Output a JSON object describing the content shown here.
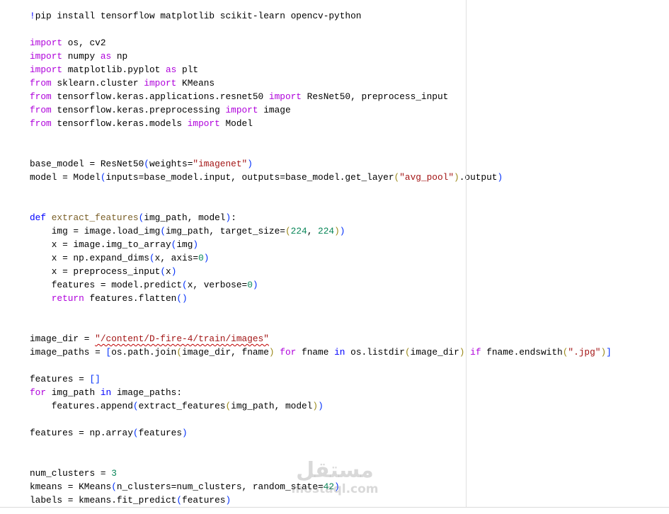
{
  "code_lines": [
    [
      [
        "b",
        "!"
      ],
      [
        "t",
        "pip install tensorflow matplotlib scikit-learn opencv-python"
      ]
    ],
    [],
    [
      [
        "k",
        "import"
      ],
      [
        "t",
        " os, cv2"
      ]
    ],
    [
      [
        "k",
        "import"
      ],
      [
        "t",
        " numpy "
      ],
      [
        "k",
        "as"
      ],
      [
        "t",
        " np"
      ]
    ],
    [
      [
        "k",
        "import"
      ],
      [
        "t",
        " matplotlib.pyplot "
      ],
      [
        "k",
        "as"
      ],
      [
        "t",
        " plt"
      ]
    ],
    [
      [
        "k",
        "from"
      ],
      [
        "t",
        " sklearn.cluster "
      ],
      [
        "k",
        "import"
      ],
      [
        "t",
        " KMeans"
      ]
    ],
    [
      [
        "k",
        "from"
      ],
      [
        "t",
        " tensorflow.keras.applications.resnet50 "
      ],
      [
        "k",
        "import"
      ],
      [
        "t",
        " ResNet50, preprocess_input"
      ]
    ],
    [
      [
        "k",
        "from"
      ],
      [
        "t",
        " tensorflow.keras.preprocessing "
      ],
      [
        "k",
        "import"
      ],
      [
        "t",
        " image"
      ]
    ],
    [
      [
        "k",
        "from"
      ],
      [
        "t",
        " tensorflow.keras.models "
      ],
      [
        "k",
        "import"
      ],
      [
        "t",
        " Model"
      ]
    ],
    [],
    [],
    [
      [
        "t",
        "base_model = ResNet50"
      ],
      [
        "p1",
        "("
      ],
      [
        "t",
        "weights="
      ],
      [
        "s",
        "\"imagenet\""
      ],
      [
        "p1",
        ")"
      ]
    ],
    [
      [
        "t",
        "model = Model"
      ],
      [
        "p1",
        "("
      ],
      [
        "t",
        "inputs=base_model.input, outputs=base_model.get_layer"
      ],
      [
        "p2",
        "("
      ],
      [
        "s",
        "\"avg_pool\""
      ],
      [
        "p2",
        ")"
      ],
      [
        "t",
        ".output"
      ],
      [
        "p1",
        ")"
      ]
    ],
    [],
    [],
    [
      [
        "b",
        "def"
      ],
      [
        "t",
        " "
      ],
      [
        "f",
        "extract_features"
      ],
      [
        "p1",
        "("
      ],
      [
        "t",
        "img_path, model"
      ],
      [
        "p1",
        ")"
      ],
      [
        "t",
        ":"
      ]
    ],
    [
      [
        "t",
        "    img = image.load_img"
      ],
      [
        "p1",
        "("
      ],
      [
        "t",
        "img_path, target_size="
      ],
      [
        "p2",
        "("
      ],
      [
        "n",
        "224"
      ],
      [
        "t",
        ", "
      ],
      [
        "n",
        "224"
      ],
      [
        "p2",
        ")"
      ],
      [
        "p1",
        ")"
      ]
    ],
    [
      [
        "t",
        "    x = image.img_to_array"
      ],
      [
        "p1",
        "("
      ],
      [
        "t",
        "img"
      ],
      [
        "p1",
        ")"
      ]
    ],
    [
      [
        "t",
        "    x = np.expand_dims"
      ],
      [
        "p1",
        "("
      ],
      [
        "t",
        "x, axis="
      ],
      [
        "n",
        "0"
      ],
      [
        "p1",
        ")"
      ]
    ],
    [
      [
        "t",
        "    x = preprocess_input"
      ],
      [
        "p1",
        "("
      ],
      [
        "t",
        "x"
      ],
      [
        "p1",
        ")"
      ]
    ],
    [
      [
        "t",
        "    features = model.predict"
      ],
      [
        "p1",
        "("
      ],
      [
        "t",
        "x, verbose="
      ],
      [
        "n",
        "0"
      ],
      [
        "p1",
        ")"
      ]
    ],
    [
      [
        "t",
        "    "
      ],
      [
        "k",
        "return"
      ],
      [
        "t",
        " features.flatten"
      ],
      [
        "p1",
        "()"
      ]
    ],
    [],
    [],
    [
      [
        "t",
        "image_dir = "
      ],
      [
        "u",
        "\"/content/D-fire-4/train/images\""
      ]
    ],
    [
      [
        "t",
        "image_paths = "
      ],
      [
        "p1",
        "["
      ],
      [
        "t",
        "os.path.join"
      ],
      [
        "p2",
        "("
      ],
      [
        "t",
        "image_dir, fname"
      ],
      [
        "p2",
        ")"
      ],
      [
        "t",
        " "
      ],
      [
        "k",
        "for"
      ],
      [
        "t",
        " fname "
      ],
      [
        "b",
        "in"
      ],
      [
        "t",
        " os.listdir"
      ],
      [
        "p2",
        "("
      ],
      [
        "t",
        "image_dir"
      ],
      [
        "p2",
        ")"
      ],
      [
        "t",
        " "
      ],
      [
        "k",
        "if"
      ],
      [
        "t",
        " fname.endswith"
      ],
      [
        "p2",
        "("
      ],
      [
        "s",
        "\".jpg\""
      ],
      [
        "p2",
        ")"
      ],
      [
        "p1",
        "]"
      ]
    ],
    [],
    [
      [
        "t",
        "features = "
      ],
      [
        "p1",
        "[]"
      ]
    ],
    [
      [
        "k",
        "for"
      ],
      [
        "t",
        " img_path "
      ],
      [
        "b",
        "in"
      ],
      [
        "t",
        " image_paths:"
      ]
    ],
    [
      [
        "t",
        "    features.append"
      ],
      [
        "p1",
        "("
      ],
      [
        "t",
        "extract_features"
      ],
      [
        "p2",
        "("
      ],
      [
        "t",
        "img_path, model"
      ],
      [
        "p2",
        ")"
      ],
      [
        "p1",
        ")"
      ]
    ],
    [],
    [
      [
        "t",
        "features = np.array"
      ],
      [
        "p1",
        "("
      ],
      [
        "t",
        "features"
      ],
      [
        "p1",
        ")"
      ]
    ],
    [],
    [],
    [
      [
        "t",
        "num_clusters = "
      ],
      [
        "n",
        "3"
      ]
    ],
    [
      [
        "t",
        "kmeans = KMeans"
      ],
      [
        "p1",
        "("
      ],
      [
        "t",
        "n_clusters=num_clusters, random_state="
      ],
      [
        "n",
        "42"
      ],
      [
        "p1",
        ")"
      ]
    ],
    [
      [
        "t",
        "labels = kmeans.fit_predict"
      ],
      [
        "p1",
        "("
      ],
      [
        "t",
        "features"
      ],
      [
        "p1",
        ")"
      ]
    ]
  ],
  "watermark": {
    "arabic": "مستقل",
    "latin": "mostaql.com"
  }
}
